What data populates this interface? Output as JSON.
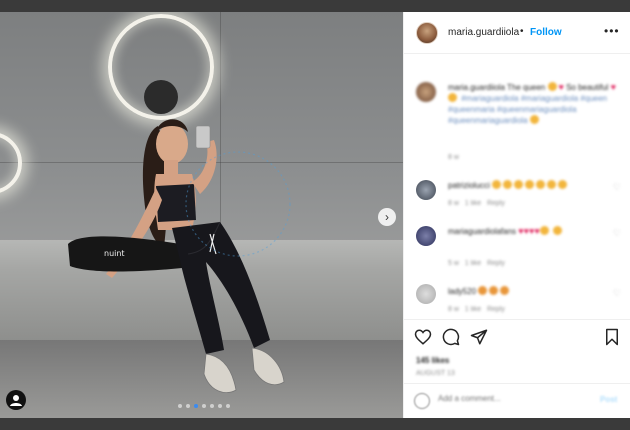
{
  "post": {
    "username": "maria.guardiiola",
    "separator": "•",
    "follow_label": "Follow",
    "more_label": "•••",
    "nav_next_label": "›",
    "carousel": {
      "count": 7,
      "active_index": 2
    }
  },
  "comments": [
    {
      "user": "maria.guardiiola",
      "text": "The queen",
      "tail": "So beautiful",
      "tags": "#mariaguardiola #mariaguardiola #queen #queenmaria #queenmariaguardiola #queenmariaguardiola",
      "meta": "8 w"
    },
    {
      "user": "patriziolucci",
      "meta_time": "8 w",
      "meta_likes": "1 like",
      "meta_reply": "Reply"
    },
    {
      "user": "mariaguardiolafans",
      "meta_time": "5 w",
      "meta_likes": "1 like",
      "meta_reply": "Reply"
    },
    {
      "user": "lady520",
      "meta_time": "8 w",
      "meta_likes": "1 like",
      "meta_reply": "Reply"
    }
  ],
  "actions": {
    "likes": "145 likes",
    "date": "AUGUST 13"
  },
  "composer": {
    "placeholder": "Add a comment...",
    "post_label": "Post"
  },
  "colors": {
    "follow": "#0095f6",
    "carousel_active": "#3b8bf0",
    "heart": "#e0245e",
    "emoji": "#f2b53c"
  }
}
